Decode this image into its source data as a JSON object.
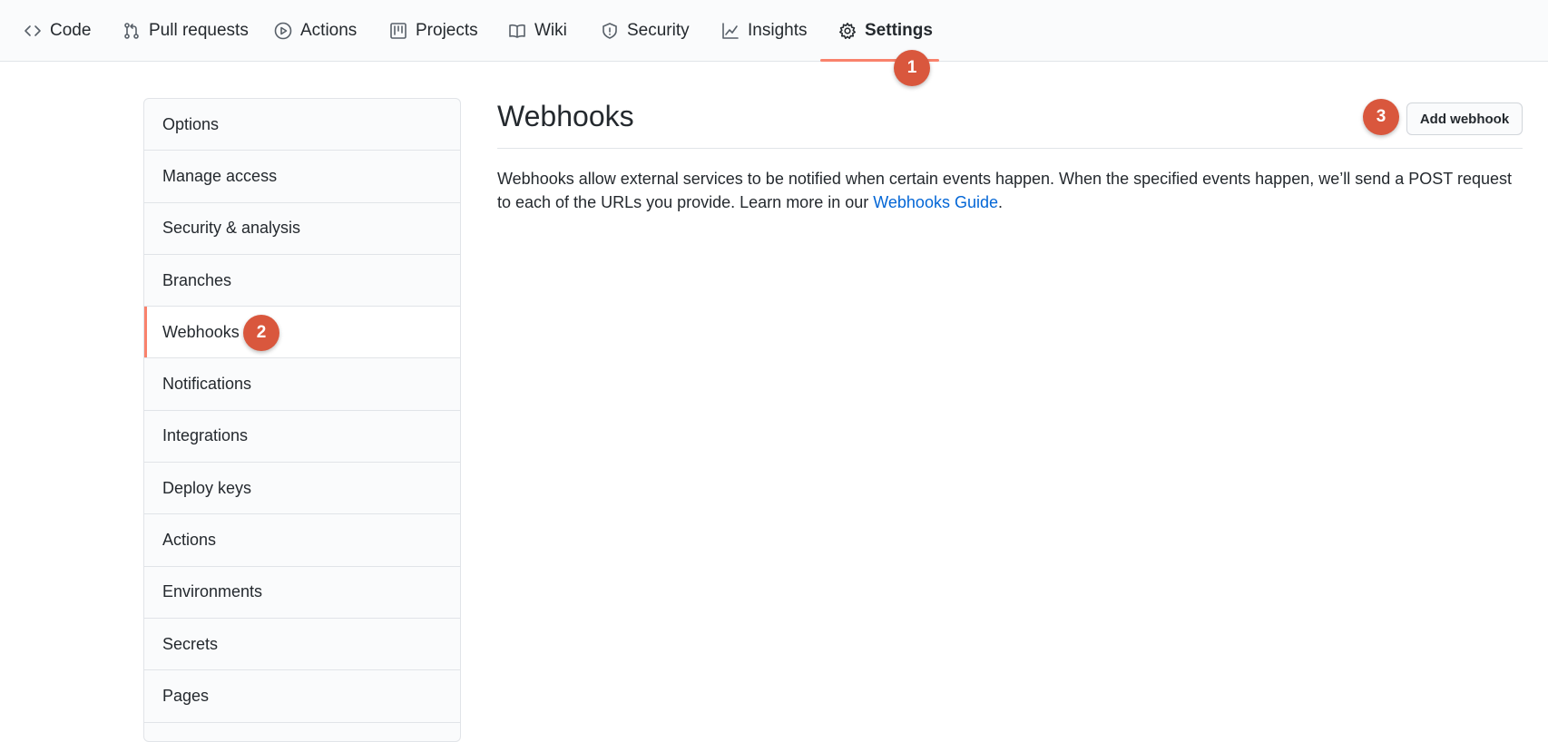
{
  "topnav": {
    "tabs": [
      {
        "label": "Code",
        "icon": "code-icon"
      },
      {
        "label": "Pull requests",
        "icon": "pull-request-icon"
      },
      {
        "label": "Actions",
        "icon": "play-icon"
      },
      {
        "label": "Projects",
        "icon": "project-icon"
      },
      {
        "label": "Wiki",
        "icon": "book-icon"
      },
      {
        "label": "Security",
        "icon": "shield-icon"
      },
      {
        "label": "Insights",
        "icon": "graph-icon"
      },
      {
        "label": "Settings",
        "icon": "gear-icon",
        "active": true
      }
    ]
  },
  "badges": {
    "step1": "1",
    "step2": "2",
    "step3": "3"
  },
  "sidebar": {
    "items": [
      {
        "label": "Options"
      },
      {
        "label": "Manage access"
      },
      {
        "label": "Security & analysis"
      },
      {
        "label": "Branches"
      },
      {
        "label": "Webhooks",
        "selected": true
      },
      {
        "label": "Notifications"
      },
      {
        "label": "Integrations"
      },
      {
        "label": "Deploy keys"
      },
      {
        "label": "Actions"
      },
      {
        "label": "Environments"
      },
      {
        "label": "Secrets"
      },
      {
        "label": "Pages"
      }
    ]
  },
  "main": {
    "title": "Webhooks",
    "add_button": "Add webhook",
    "description_before": "Webhooks allow external services to be notified when certain events happen. When the specified events happen, we’ll send a POST request to each of the URLs you provide. Learn more in our ",
    "description_link": "Webhooks Guide",
    "description_after": "."
  },
  "colors": {
    "accent_underline": "#f9826c",
    "badge": "#d9573d",
    "link": "#0366d6"
  }
}
